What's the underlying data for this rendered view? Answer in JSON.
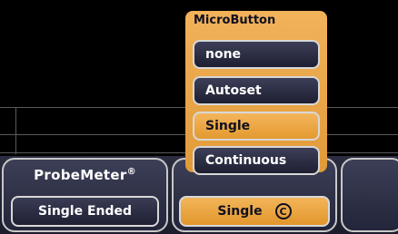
{
  "probemeter": {
    "title": "ProbeMeter",
    "registered_mark": "®",
    "value": "Single Ended"
  },
  "microbutton_softkey": {
    "value": "Single",
    "badge": "C"
  },
  "menu": {
    "title": "MicroButton",
    "items": [
      {
        "label": "none"
      },
      {
        "label": "Autoset"
      },
      {
        "label": "Single"
      },
      {
        "label": "Continuous"
      }
    ],
    "selected": "Single"
  },
  "colors": {
    "accent_orange": "#e8a040",
    "button_dark": "#2a2c44"
  }
}
